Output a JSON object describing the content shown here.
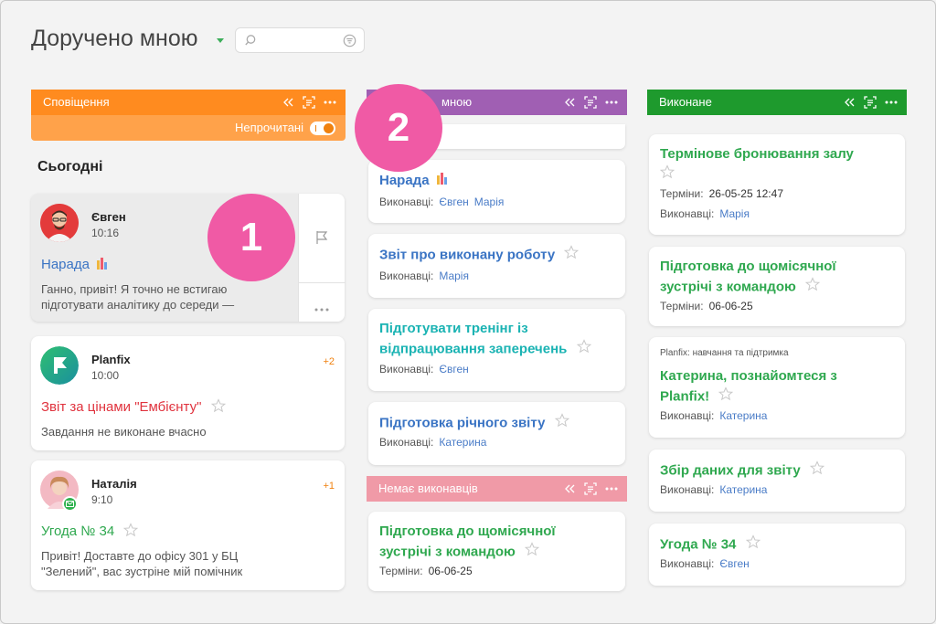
{
  "header": {
    "title": "Доручено мною",
    "search_placeholder": ""
  },
  "columns": {
    "notifications": {
      "label": "Сповіщення",
      "color": "#ff8b1f",
      "unread_label": "Непрочитані",
      "unread_on": true,
      "today_label": "Сьогодні",
      "items": [
        {
          "name": "Євген",
          "time": "10:16",
          "task": "Нарада",
          "text": "Ганно, привіт! Я точно не встигаю підготувати аналітику до середи —",
          "count": ""
        },
        {
          "name": "Planfix",
          "time": "10:00",
          "task": "Звіт за цінами \"Ембієнту\"",
          "text": "Завдання не виконане вчасно",
          "count": "+2"
        },
        {
          "name": "Наталія",
          "time": "9:10",
          "task": "Угода № 34",
          "text": "Привіт! Доставте до офісу 301 у БЦ \"Зелений\", вас зустріне мій помічник",
          "count": "+1"
        }
      ]
    },
    "assigned": {
      "label": "мною",
      "color": "#a05fb3",
      "tasks": [
        {
          "title": "Нарада",
          "meta_label": "Виконавці:",
          "people": [
            "Євген",
            "Марія"
          ]
        },
        {
          "title": "Звіт про виконану роботу",
          "meta_label": "Виконавці:",
          "people": [
            "Марія"
          ]
        },
        {
          "title": "Підготувати тренінг із відпрацювання заперечень",
          "meta_label": "Виконавці:",
          "people": [
            "Євген"
          ]
        },
        {
          "title": "Підготовка річного звіту",
          "meta_label": "Виконавці:",
          "people": [
            "Катерина"
          ]
        }
      ]
    },
    "no_assignee": {
      "label": "Немає виконавців",
      "color": "#f09aa7",
      "tasks": [
        {
          "title": "Підготовка до щомісячної зустрічі з командою",
          "meta_label": "Терміни:",
          "value": "06-06-25"
        }
      ]
    },
    "done": {
      "label": "Виконане",
      "color": "#1e9a2d",
      "tasks": [
        {
          "title": "Термінове бронювання залу",
          "deadline_label": "Терміни:",
          "deadline": "26-05-25 12:47",
          "people_label": "Виконавці:",
          "people": [
            "Марія"
          ]
        },
        {
          "title": "Підготовка до щомісячної зустрічі з командою",
          "deadline_label": "Терміни:",
          "deadline": "06-06-25"
        },
        {
          "project": "Planfix: навчання та підтримка",
          "title": "Катерина, познайомтеся з Planfix!",
          "people_label": "Виконавці:",
          "people": [
            "Катерина"
          ]
        },
        {
          "title": "Збір даних для звіту",
          "people_label": "Виконавці:",
          "people": [
            "Катерина"
          ]
        },
        {
          "title": "Угода № 34",
          "people_label": "Виконавці:",
          "people": [
            "Євген"
          ]
        }
      ]
    }
  },
  "callouts": [
    "1",
    "2"
  ]
}
